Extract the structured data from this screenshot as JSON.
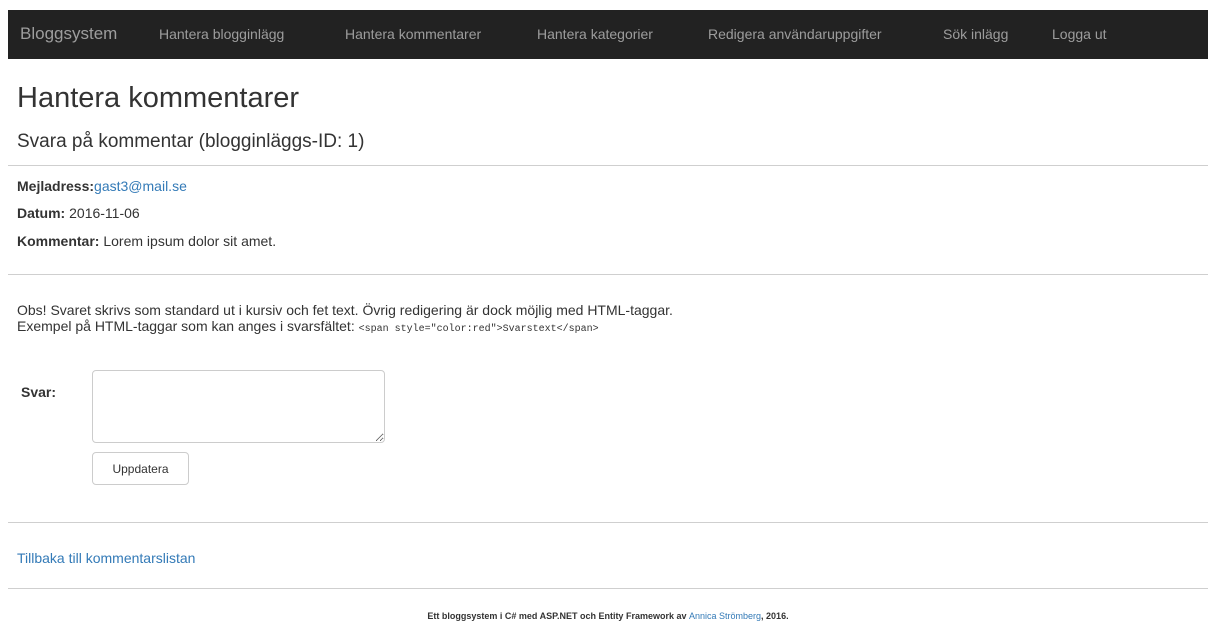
{
  "navbar": {
    "brand": "Bloggsystem",
    "items": [
      {
        "label": "Hantera blogginlägg"
      },
      {
        "label": "Hantera kommentarer"
      },
      {
        "label": "Hantera kategorier"
      },
      {
        "label": "Redigera användaruppgifter"
      },
      {
        "label": "Sök inlägg"
      },
      {
        "label": "Logga ut"
      }
    ]
  },
  "page": {
    "title": "Hantera kommentarer",
    "subtitle": "Svara på kommentar (blogginläggs-ID: 1)"
  },
  "comment": {
    "email_label": "Mejladress:",
    "email": "gast3@mail.se",
    "date_label": "Datum:",
    "date": "2016-11-06",
    "comment_label": "Kommentar:",
    "comment": "Lorem ipsum dolor sit amet."
  },
  "note": {
    "line1": "Obs! Svaret skrivs som standard ut i kursiv och fet text. Övrig redigering är dock möjlig med HTML-taggar.",
    "line2": "Exempel på HTML-taggar som kan anges i svarsfältet:",
    "code_example": "<span style=\"color:red\">Svarstext</span>"
  },
  "form": {
    "reply_label": "Svar:",
    "reply_value": "",
    "submit_label": "Uppdatera"
  },
  "back_link": "Tillbaka till kommentarslistan",
  "footer": {
    "text_before": "Ett bloggsystem i C# med ASP.NET och Entity Framework av",
    "author": "Annica Strömberg",
    "text_after": ", 2016."
  },
  "colors": {
    "navbar_bg": "#222222",
    "nav_text": "#9d9d9d",
    "link": "#337ab7"
  }
}
